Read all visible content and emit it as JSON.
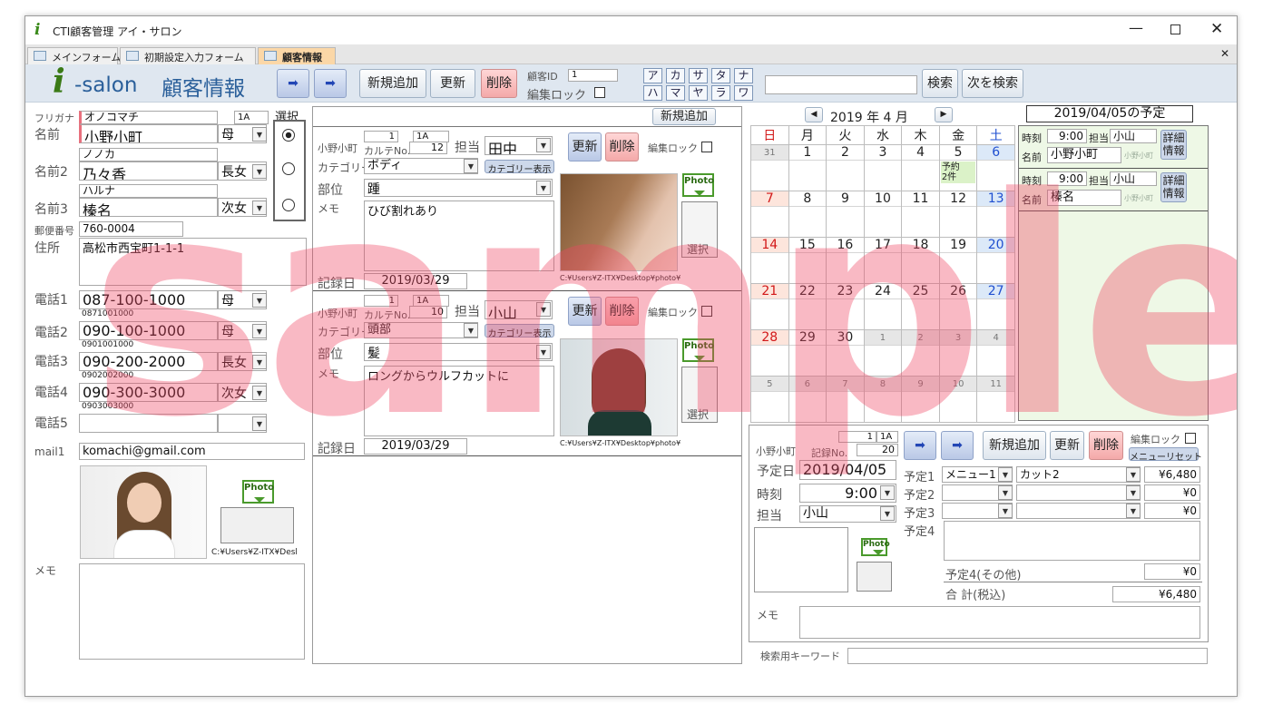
{
  "app": {
    "title": "CTI顧客管理 アイ・サロン",
    "logo_text": "-salon"
  },
  "tabs": [
    {
      "label": "メインフォーム"
    },
    {
      "label": "初期設定入力フォーム"
    },
    {
      "label": "顧客情報"
    }
  ],
  "header": {
    "form_title": "顧客情報",
    "new_label": "新規追加",
    "update_label": "更新",
    "delete_label": "削除",
    "customer_id_label": "顧客ID",
    "customer_id": "1",
    "edit_lock_label": "編集ロック",
    "search_label": "検索",
    "next_search_label": "次を検索",
    "search_value": "",
    "kana_row1": [
      "ア",
      "カ",
      "サ",
      "タ",
      "ナ"
    ],
    "kana_row2": [
      "ハ",
      "マ",
      "ヤ",
      "ラ",
      "ワ"
    ]
  },
  "customer": {
    "furigana_label": "フリガナ",
    "furigana": "オノコマチ",
    "code": "1A",
    "select_label": "選択",
    "name_label": "名前",
    "name": "小野小町",
    "relation1": "母",
    "furigana2": "ノノカ",
    "name2_label": "名前2",
    "name2": "乃々香",
    "relation2": "長女",
    "furigana3": "ハルナ",
    "name3_label": "名前3",
    "name3": "榛名",
    "relation3": "次女",
    "zip_label": "郵便番号",
    "zip": "760-0004",
    "address_label": "住所",
    "address": "高松市西宝町1-1-1",
    "phones": [
      {
        "label": "電話1",
        "value": "087-100-1000",
        "sub": "0871001000",
        "rel": "母"
      },
      {
        "label": "電話2",
        "value": "090-100-1000",
        "sub": "0901001000",
        "rel": "母"
      },
      {
        "label": "電話3",
        "value": "090-200-2000",
        "sub": "0902002000",
        "rel": "長女"
      },
      {
        "label": "電話4",
        "value": "090-300-3000",
        "sub": "0903003000",
        "rel": "次女"
      },
      {
        "label": "電話5",
        "value": "",
        "sub": "",
        "rel": ""
      }
    ],
    "mail_label": "mail1",
    "mail": "komachi@gmail.com",
    "photo_path": "C:¥Users¥Z-ITX¥Desl",
    "memo_label": "メモ",
    "photo_badge": "Photo"
  },
  "records": {
    "new_label": "新規追加",
    "items": [
      {
        "num": "1",
        "code": "1A",
        "name": "小野小町",
        "karte_label": "カルテNo.",
        "karte": "12",
        "staff_label": "担当",
        "staff": "田中",
        "update": "更新",
        "delete": "削除",
        "lock": "編集ロック",
        "cat_label": "カテゴリー",
        "cat": "ボディ",
        "cat_btn": "カテゴリー表示",
        "part_label": "部位",
        "part": "踵",
        "memo_label": "メモ",
        "memo": "ひび割れあり",
        "date_label": "記録日",
        "date": "2019/03/29",
        "path": "C:¥Users¥Z-ITX¥Desktop¥photo¥",
        "select": "選択",
        "badge": "Photo"
      },
      {
        "num": "1",
        "code": "1A",
        "name": "小野小町",
        "karte_label": "カルテNo.",
        "karte": "10",
        "staff_label": "担当",
        "staff": "小山",
        "update": "更新",
        "delete": "削除",
        "lock": "編集ロック",
        "cat_label": "カテゴリー",
        "cat": "頭部",
        "cat_btn": "カテゴリー表示",
        "part_label": "部位",
        "part": "髪",
        "memo_label": "メモ",
        "memo": "ロングからウルフカットに",
        "date_label": "記録日",
        "date": "2019/03/29",
        "path": "C:¥Users¥Z-ITX¥Desktop¥photo¥",
        "select": "選択",
        "badge": "Photo"
      }
    ]
  },
  "calendar": {
    "year_label": "2019 年 4 月",
    "weekdays": [
      "日",
      "月",
      "火",
      "水",
      "木",
      "金",
      "土"
    ],
    "weeks": [
      [
        "31",
        "1",
        "2",
        "3",
        "4",
        "5",
        "6"
      ],
      [
        "7",
        "8",
        "9",
        "10",
        "11",
        "12",
        "13"
      ],
      [
        "14",
        "15",
        "16",
        "17",
        "18",
        "19",
        "20"
      ],
      [
        "21",
        "22",
        "23",
        "24",
        "25",
        "26",
        "27"
      ],
      [
        "28",
        "29",
        "30",
        "1",
        "2",
        "3",
        "4"
      ],
      [
        "5",
        "6",
        "7",
        "8",
        "9",
        "10",
        "11"
      ]
    ],
    "note": "予約\n2件"
  },
  "schedule": {
    "title": "2019/04/05の予定",
    "entries": [
      {
        "time_label": "時刻",
        "time": "9:00",
        "staff_label": "担当",
        "staff": "小山",
        "name_label": "名前",
        "name": "小野小町",
        "small": "小野小町",
        "detail": "詳細\n情報"
      },
      {
        "time_label": "時刻",
        "time": "9:00",
        "staff_label": "担当",
        "staff": "小山",
        "name_label": "名前",
        "name": "榛名",
        "small": "小野小町",
        "detail": "詳細\n情報"
      }
    ]
  },
  "reservation": {
    "num": "1",
    "code": "1A",
    "name": "小野小町",
    "rec_label": "記録No.",
    "rec": "20",
    "new": "新規追加",
    "update": "更新",
    "delete": "削除",
    "lock": "編集ロック",
    "menu_reset": "メニューリセット",
    "date_label": "予定日",
    "date": "2019/04/05",
    "time_label": "時刻",
    "time": "9:00",
    "staff_label": "担当",
    "staff": "小山",
    "plans": [
      {
        "label": "予定1",
        "menu": "メニュー1",
        "item": "カット2",
        "price": "¥6,480"
      },
      {
        "label": "予定2",
        "menu": "",
        "item": "",
        "price": "¥0"
      },
      {
        "label": "予定3",
        "menu": "",
        "item": "",
        "price": "¥0"
      }
    ],
    "plan4_label": "予定4",
    "other_label": "予定4(その他)",
    "other_price": "¥0",
    "total_label": "合 計(税込)",
    "total": "¥6,480",
    "memo_label": "メモ",
    "keyword_label": "検索用キーワード",
    "badge": "Photo"
  },
  "watermark": "sample",
  "colors": {
    "accent": "#e8707d",
    "sat": "#1f4fd0",
    "sun": "#d21818",
    "header": "#dfe7f0"
  }
}
